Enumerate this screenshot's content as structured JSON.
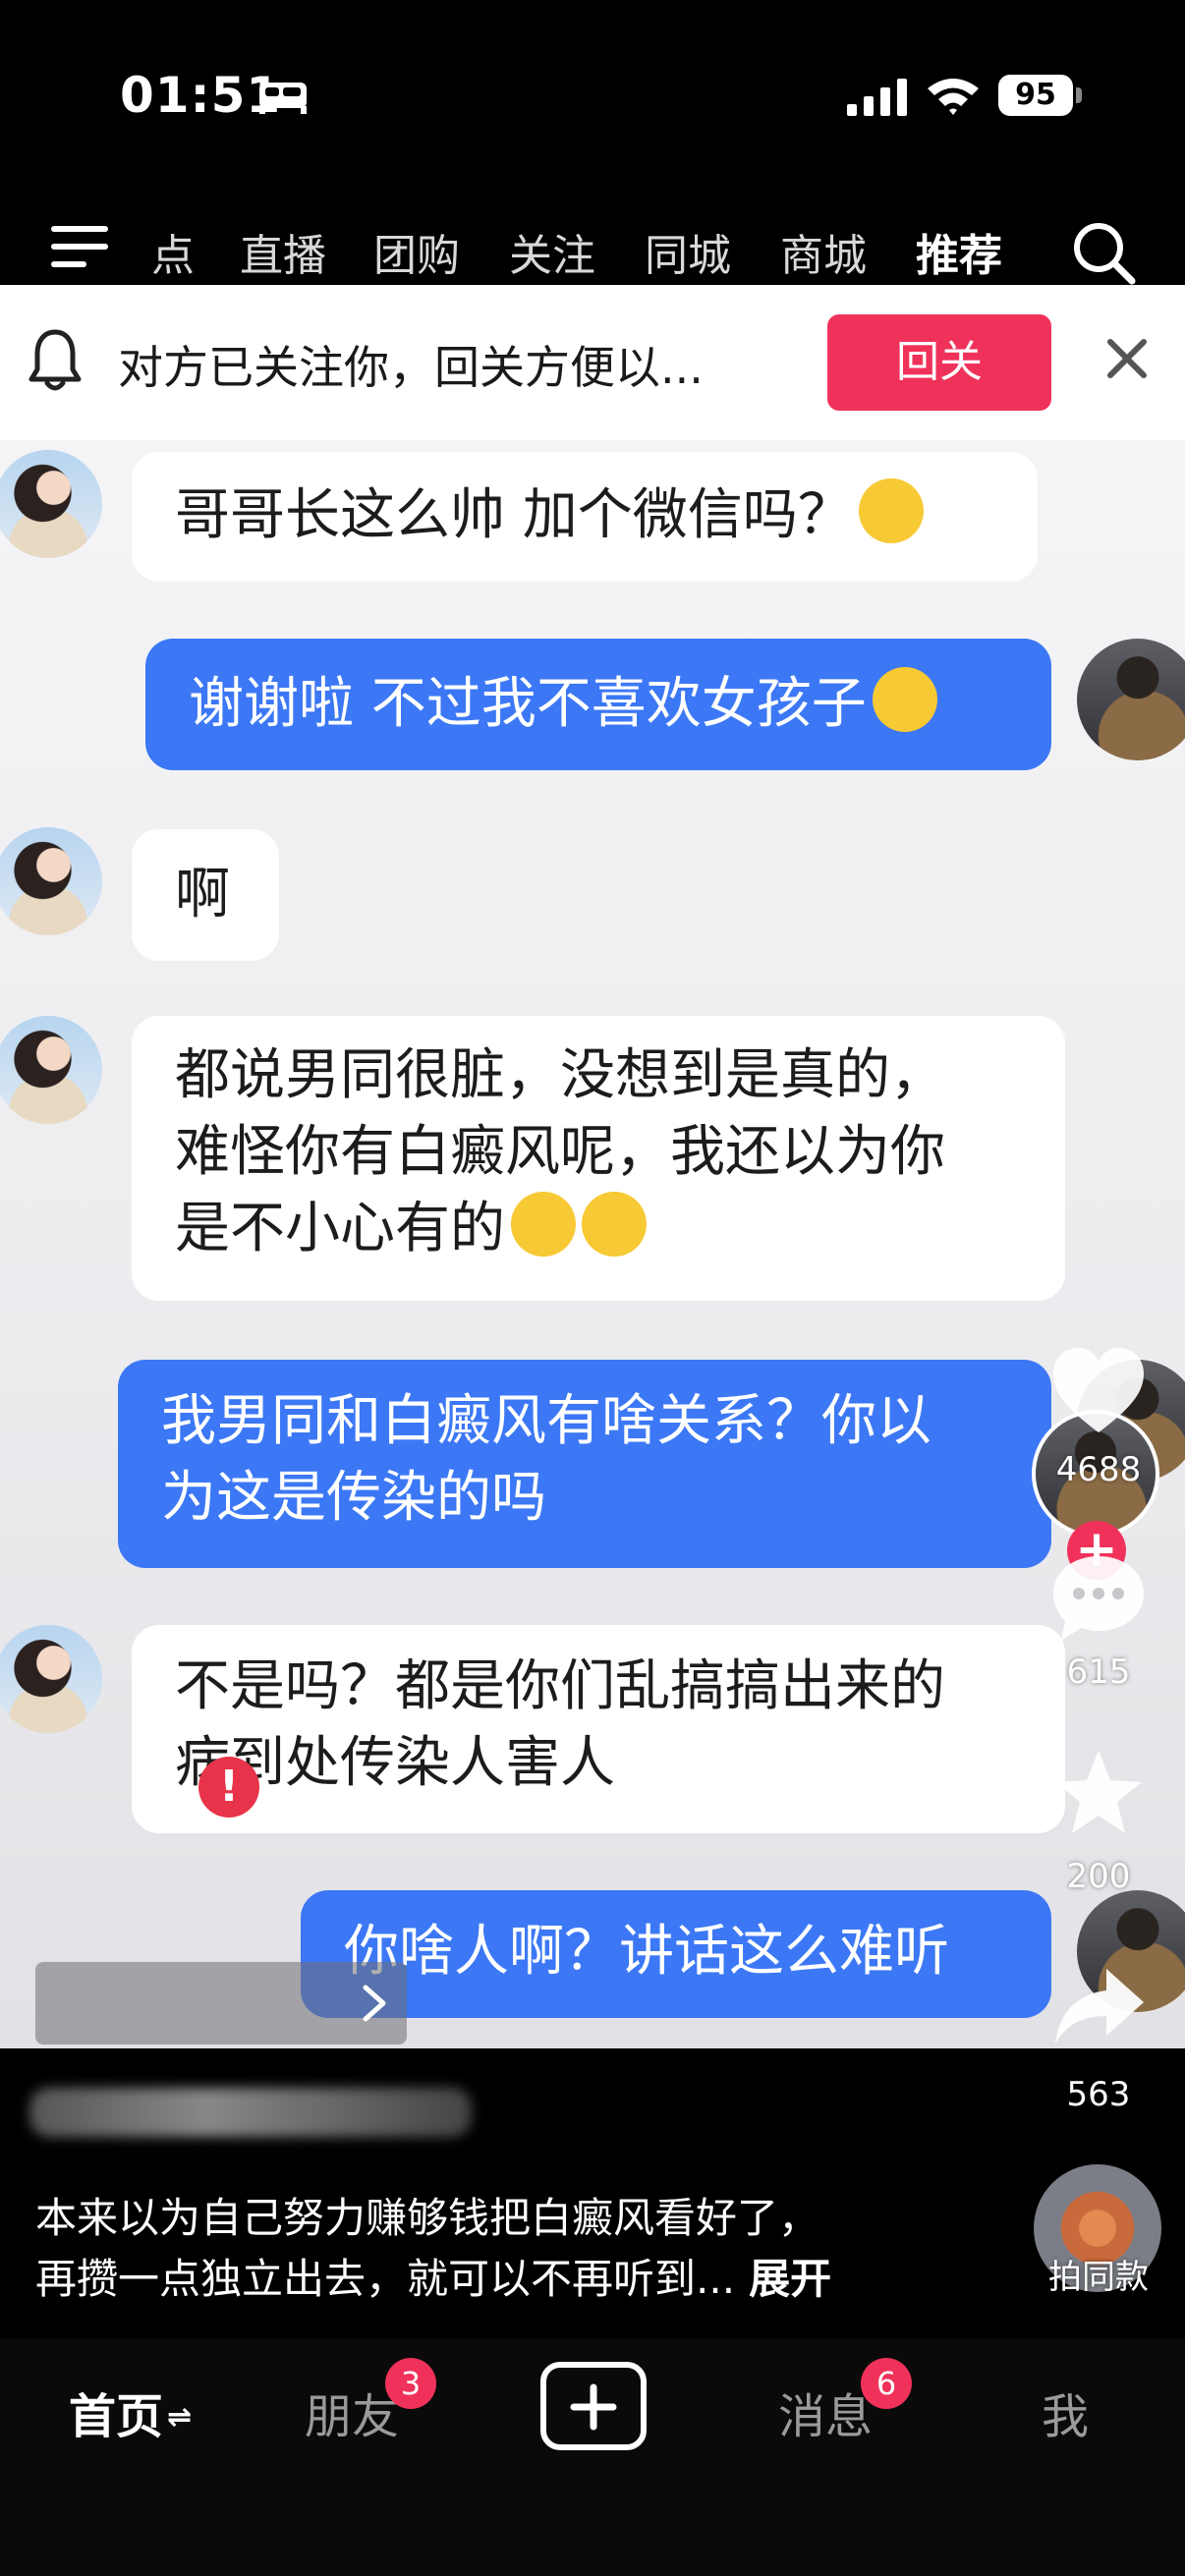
{
  "status_bar": {
    "time": "01:51",
    "battery": "95"
  },
  "top_nav": {
    "tabs": [
      {
        "label": "点",
        "active": false
      },
      {
        "label": "直播",
        "active": false
      },
      {
        "label": "团购",
        "active": false
      },
      {
        "label": "关注",
        "active": false
      },
      {
        "label": "同城",
        "active": false
      },
      {
        "label": "商城",
        "active": false
      },
      {
        "label": "推荐",
        "active": true
      }
    ]
  },
  "notification": {
    "text": "对方已关注你，回关方便以...",
    "button_label": "回关"
  },
  "chat": {
    "messages": [
      {
        "side": "in",
        "text": "哥哥长这么帅 加个微信吗？"
      },
      {
        "side": "out",
        "text": "谢谢啦 不过我不喜欢女孩子"
      },
      {
        "side": "in",
        "text": "啊"
      },
      {
        "side": "in",
        "lines": [
          "都说男同很脏，没想到是真的，",
          "难怪你有白癜风呢，我还以为你",
          "是不小心有的"
        ]
      },
      {
        "side": "out",
        "lines": [
          "我男同和白癜风有啥关系？你以",
          "为这是传染的吗"
        ]
      },
      {
        "side": "in",
        "lines": [
          "不是吗？都是你们乱搞搞出来的",
          "病到处传染人害人"
        ]
      },
      {
        "side": "out",
        "text": "你啥人啊？讲话这么难听"
      }
    ]
  },
  "actions": {
    "likes": "4688",
    "comments": "615",
    "favorites": "200",
    "shares": "563"
  },
  "description": {
    "line1": "本来以为自己努力赚够钱把白癜风看好了，",
    "line2": "再攒一点独立出去，就可以不再听到...",
    "more": "展开"
  },
  "music": {
    "same_style_label": "拍同款"
  },
  "tab_bar": {
    "tabs": [
      {
        "label": "首页",
        "active": true,
        "switch": "⇌"
      },
      {
        "label": "朋友",
        "badge": "3"
      },
      {
        "label": "消息",
        "badge": "6"
      },
      {
        "label": "我"
      }
    ]
  },
  "colors": {
    "accent": "#f0325a",
    "bubble_out": "#3c78f5",
    "bubble_in": "#ffffff"
  }
}
